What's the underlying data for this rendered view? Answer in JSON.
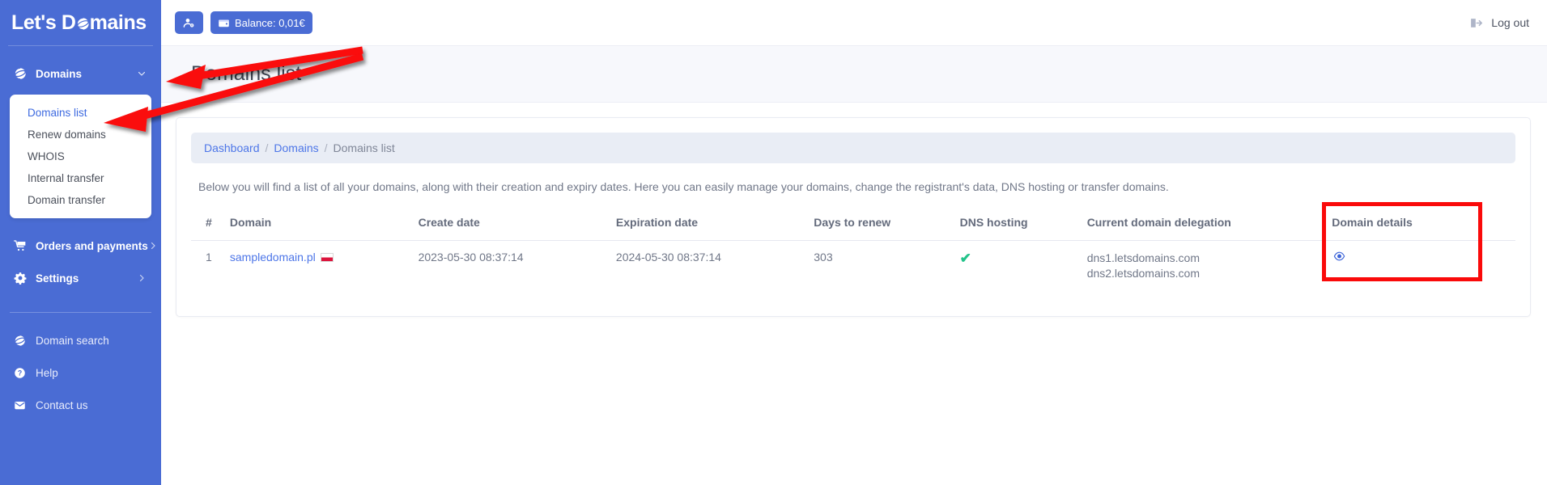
{
  "brand": {
    "name_before": "Let's D",
    "name_after": "mains",
    "globe_icon": "globe-icon"
  },
  "topbar": {
    "account_button": {
      "icon": "user-settings-icon",
      "label": ""
    },
    "balance_button": {
      "icon": "wallet-icon",
      "label": "Balance: 0,01€"
    },
    "logout": {
      "icon": "sign-out-icon",
      "label": "Log out"
    }
  },
  "sidebar": {
    "items": [
      {
        "label": "Domains",
        "icon": "globe-icon",
        "chevron": "chevron-down-icon",
        "expanded": true,
        "active": true
      },
      {
        "label": "Orders and payments",
        "icon": "cart-icon",
        "chevron": "chevron-right-icon",
        "expanded": false,
        "active": false
      },
      {
        "label": "Settings",
        "icon": "gear-icon",
        "chevron": "chevron-right-icon",
        "expanded": false,
        "active": false
      }
    ],
    "submenu": [
      {
        "label": "Domains list",
        "active": true
      },
      {
        "label": "Renew domains",
        "active": false
      },
      {
        "label": "WHOIS",
        "active": false
      },
      {
        "label": "Internal transfer",
        "active": false
      },
      {
        "label": "Domain transfer",
        "active": false
      }
    ],
    "bottom_items": [
      {
        "label": "Domain search",
        "icon": "globe-icon"
      },
      {
        "label": "Help",
        "icon": "question-circle-icon"
      },
      {
        "label": "Contact us",
        "icon": "envelope-icon"
      }
    ]
  },
  "page": {
    "title": "Domains list",
    "breadcrumb": [
      {
        "label": "Dashboard",
        "link": true
      },
      {
        "label": "Domains",
        "link": true
      },
      {
        "label": "Domains list",
        "link": false
      }
    ],
    "breadcrumb_separator": "/",
    "description": "Below you will find a list of all your domains, along with their creation and expiry dates. Here you can easily manage your domains, change the registrant's data, DNS hosting or transfer domains."
  },
  "table": {
    "headers": {
      "num": "#",
      "domain": "Domain",
      "create_date": "Create date",
      "expiration_date": "Expiration date",
      "days_to_renew": "Days to renew",
      "dns_hosting": "DNS hosting",
      "delegation": "Current domain delegation",
      "details": "Domain details"
    },
    "rows": [
      {
        "num": "1",
        "domain": "sampledomain.pl",
        "flag": "flag-pl",
        "create_date": "2023-05-30 08:37:14",
        "expiration_date": "2024-05-30 08:37:14",
        "days_to_renew": "303",
        "dns_hosting": "✔",
        "delegation_ns1": "dns1.letsdomains.com",
        "delegation_ns2": "dns2.letsdomains.com",
        "details_icon": "eye-icon"
      }
    ]
  },
  "colors": {
    "sidebar_blue": "#4a6cd4",
    "link_blue": "#4d76e8",
    "annotation_red": "#fa0a0a",
    "check_green": "#23c38a"
  }
}
